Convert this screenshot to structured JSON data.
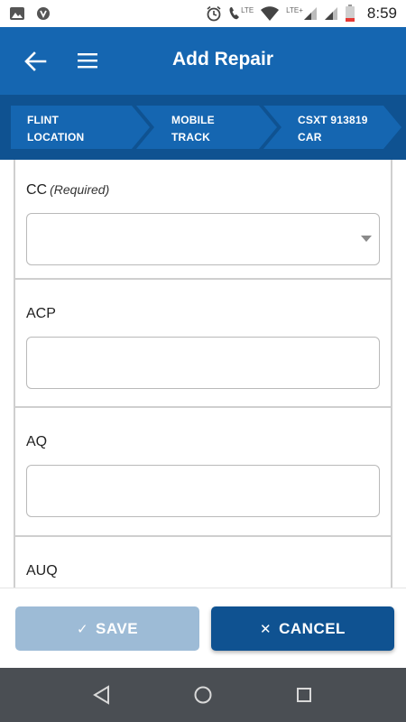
{
  "status_bar": {
    "network_small_label": "LTE",
    "network_small_label_2": "LTE+",
    "time": "8:59"
  },
  "app_bar": {
    "title": "Add Repair",
    "back_icon": "arrow-left-icon",
    "menu_icon": "hamburger-menu-icon"
  },
  "breadcrumbs": [
    {
      "line1": "FLINT",
      "line2": "LOCATION"
    },
    {
      "line1": "MOBILE",
      "line2": "TRACK"
    },
    {
      "line1": "CSXT 913819",
      "line2": "CAR"
    }
  ],
  "form": {
    "fields": [
      {
        "label": "CC",
        "required_note": "(Required)",
        "value": "",
        "type": "select"
      },
      {
        "label": "ACP",
        "value": "",
        "type": "text"
      },
      {
        "label": "AQ",
        "value": "",
        "type": "text"
      },
      {
        "label": "AUQ",
        "value": "",
        "type": "text"
      }
    ]
  },
  "actions": {
    "save_label": "SAVE",
    "save_icon": "check-icon",
    "cancel_label": "CANCEL",
    "cancel_icon": "close-icon"
  },
  "colors": {
    "app_bar": "#1566b1",
    "breadcrumb_band": "#0f5291",
    "breadcrumb_chevron": "#1566b1",
    "save_disabled": "#9dbbd6",
    "cancel": "#0f5291",
    "nav_bar": "#4a4e53"
  },
  "navigation_bar": {
    "back_icon": "nav-back-triangle-icon",
    "home_icon": "nav-home-circle-icon",
    "recents_icon": "nav-recents-square-icon"
  }
}
